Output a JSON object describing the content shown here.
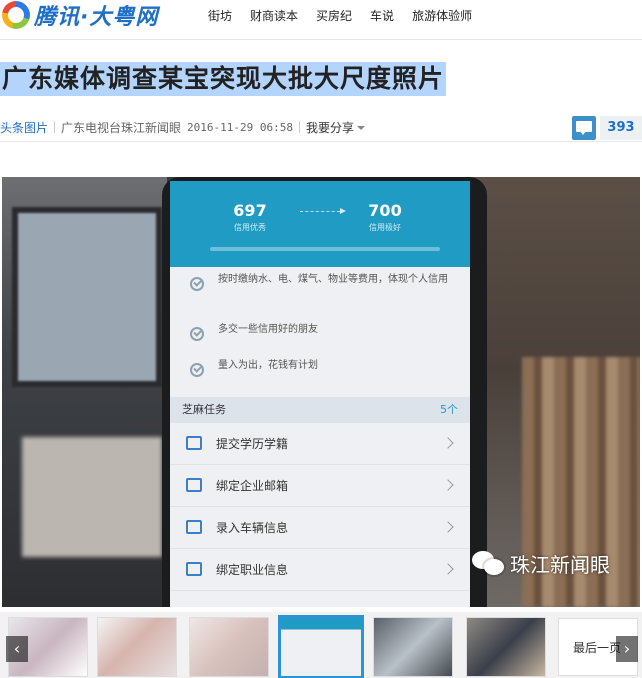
{
  "logo": {
    "text": "腾讯·大粤网"
  },
  "nav": {
    "items": [
      "街坊",
      "财商读本",
      "买房纪",
      "车说",
      "旅游体验师"
    ]
  },
  "article": {
    "title": "广东媒体调查某宝突现大批大尺度照片",
    "category": "头条图片",
    "source": "广东电视台珠江新闻眼",
    "time": "2016-11-29 06:58",
    "share_label": "我要分享",
    "comment_count": "393"
  },
  "photo": {
    "score_from": "697",
    "score_from_label": "信用优秀",
    "score_to": "700",
    "score_to_label": "信用极好",
    "tips": [
      "按时缴纳水、电、煤气、物业等费用，体现个人信用",
      "多交一些信用好的朋友",
      "量入为出，花钱有计划"
    ],
    "task_header": "芝麻任务",
    "task_count": "5个",
    "tasks": [
      "提交学历学籍",
      "绑定企业邮箱",
      "录入车辆信息",
      "绑定职业信息"
    ],
    "watermark": "珠江新闻眼"
  },
  "gallery": {
    "last_page_label": "最后一页",
    "prev_icon": "‹",
    "next_icon": "›"
  }
}
